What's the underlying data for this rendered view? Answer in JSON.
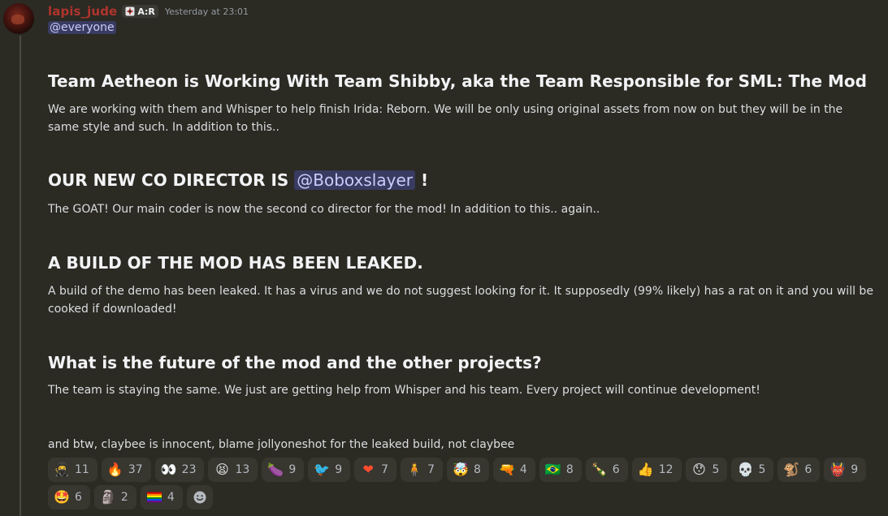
{
  "author": {
    "username": "lapis_jude",
    "role_tag": "A:R",
    "timestamp": "Yesterday at 23:01"
  },
  "mention_everyone": "@everyone",
  "sections": [
    {
      "heading": "Team Aetheon is Working With Team Shibby, aka the Team Responsible for SML: The Mod",
      "body": "We are working with them and Whisper to help finish Irida: Reborn. We will be only using original assets from now on but they will be in the same style and such. In addition to this.."
    },
    {
      "heading_prefix": "OUR NEW CO DIRECTOR IS",
      "heading_mention": "@Boboxslayer",
      "heading_suffix": "!",
      "body": "The GOAT! Our main coder is now the second co director for the mod! In addition to this.. again.."
    },
    {
      "heading": "A BUILD OF THE MOD HAS BEEN LEAKED.",
      "body": "A build of the demo has been leaked. It has a virus and we do not suggest looking for it. It supposedly (99% likely) has a rat on it and you will be cooked if downloaded!"
    },
    {
      "heading": "What is the future of the mod and the other projects?",
      "body": "The team is staying the same.  We just are getting help from Whisper and his team. Every project will continue development!"
    }
  ],
  "footer_text": "and btw, claybee is innocent, blame jollyoneshot for the leaked build, not claybee",
  "reactions": [
    {
      "icon": "ninja",
      "glyph": "🥷",
      "count": "11"
    },
    {
      "icon": "fire",
      "glyph": "🔥",
      "count": "37"
    },
    {
      "icon": "eyes",
      "glyph": "👀",
      "count": "23"
    },
    {
      "icon": "tired-face",
      "glyph": "😫",
      "count": "13"
    },
    {
      "icon": "eggplant",
      "glyph": "🍆",
      "count": "9"
    },
    {
      "icon": "custom-bird",
      "glyph": "🐦",
      "count": "9"
    },
    {
      "icon": "heart-on-fire",
      "glyph": "❤",
      "count": "7"
    },
    {
      "icon": "custom-figure",
      "glyph": "🧍",
      "count": "7"
    },
    {
      "icon": "exploding-head",
      "glyph": "🤯",
      "count": "8"
    },
    {
      "icon": "custom-gun",
      "glyph": "🔫",
      "count": "4"
    },
    {
      "icon": "flag-brazil",
      "glyph": "🇧🇷",
      "count": "8"
    },
    {
      "icon": "custom-bottle",
      "glyph": "🍾",
      "count": "6"
    },
    {
      "icon": "thumbs-up",
      "glyph": "👍",
      "count": "12"
    },
    {
      "icon": "hushed-face",
      "glyph": "😯",
      "count": "5"
    },
    {
      "icon": "skull",
      "glyph": "💀",
      "count": "5"
    },
    {
      "icon": "custom-monkey",
      "glyph": "🐒",
      "count": "6"
    },
    {
      "icon": "custom-red-face",
      "glyph": "👹",
      "count": "9"
    },
    {
      "icon": "star-struck",
      "glyph": "🤩",
      "count": "6"
    },
    {
      "icon": "custom-image",
      "glyph": "🗿",
      "count": "2"
    },
    {
      "icon": "rainbow-flag",
      "glyph": "🏳",
      "count": "4"
    }
  ],
  "colors": {
    "background": "#2b2a23",
    "username": "#b0342c",
    "mention_bg": "#3c3f6e",
    "mention_text": "#c9cdfb",
    "reaction_bg": "#37362f"
  }
}
